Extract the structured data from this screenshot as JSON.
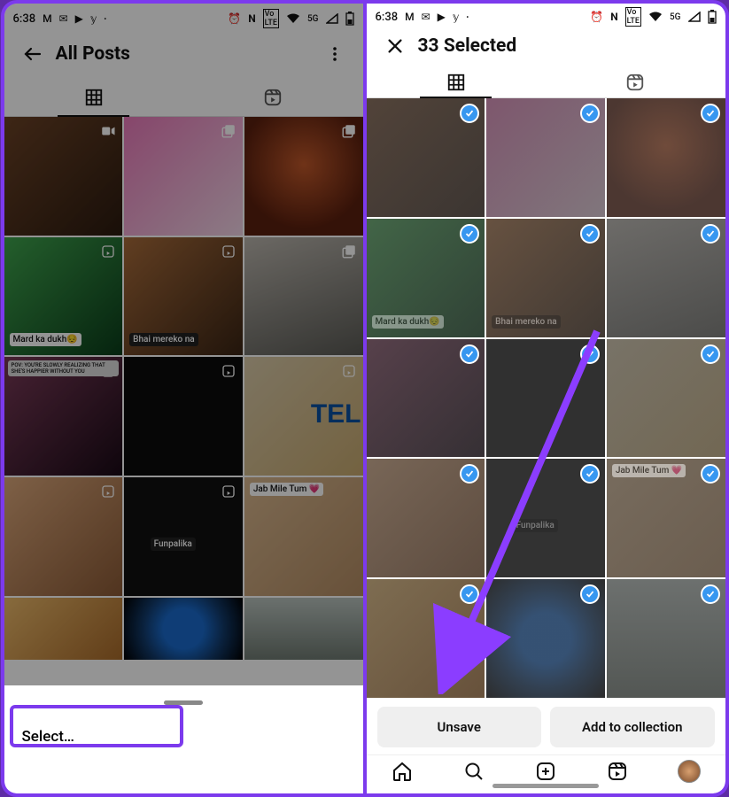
{
  "status": {
    "time": "6:38",
    "icons_left": [
      "gmail-icon",
      "mail-icon",
      "youtube-icon",
      "twitter-icon"
    ],
    "icons_right": [
      "alarm-icon",
      "nfc-icon",
      "volte-icon",
      "wifi-icon",
      "5g-icon",
      "signal-icon",
      "battery-icon"
    ],
    "net_label": "5G"
  },
  "left": {
    "header": {
      "title": "All Posts"
    },
    "tabs": {
      "grid_active": true
    },
    "sheet": {
      "option": "Select…"
    },
    "posts": [
      {
        "thumb": "t1",
        "badge": "video"
      },
      {
        "thumb": "t2",
        "badge": "carousel"
      },
      {
        "thumb": "t3",
        "badge": "carousel"
      },
      {
        "thumb": "t4",
        "badge": "reel",
        "caption": "Mard ka dukh😔"
      },
      {
        "thumb": "t5",
        "badge": "reel",
        "caption": "Bhai mereko na",
        "caption_style": "dark"
      },
      {
        "thumb": "t6",
        "badge": "carousel"
      },
      {
        "thumb": "t7",
        "badge": "reel",
        "topcap": "POV: YOU'RE SLOWLY REALIZING THAT SHE'S HAPPIER WITHOUT YOU"
      },
      {
        "thumb": "t8",
        "badge": "reel"
      },
      {
        "thumb": "t9",
        "badge": "reel",
        "sidetext": "TEL"
      },
      {
        "thumb": "t10",
        "badge": "reel"
      },
      {
        "thumb": "t11",
        "badge": "reel",
        "caption": "Funpalika",
        "caption_style": "dark"
      },
      {
        "thumb": "t12",
        "caption": "Jab Mile Tum 💗",
        "caption_style": "tag"
      },
      {
        "thumb": "t13"
      },
      {
        "thumb": "t14"
      },
      {
        "thumb": "t15"
      }
    ]
  },
  "right": {
    "header": {
      "title": "33 Selected"
    },
    "actions": {
      "unsave": "Unsave",
      "add": "Add to collection"
    },
    "posts_selected": 33
  }
}
